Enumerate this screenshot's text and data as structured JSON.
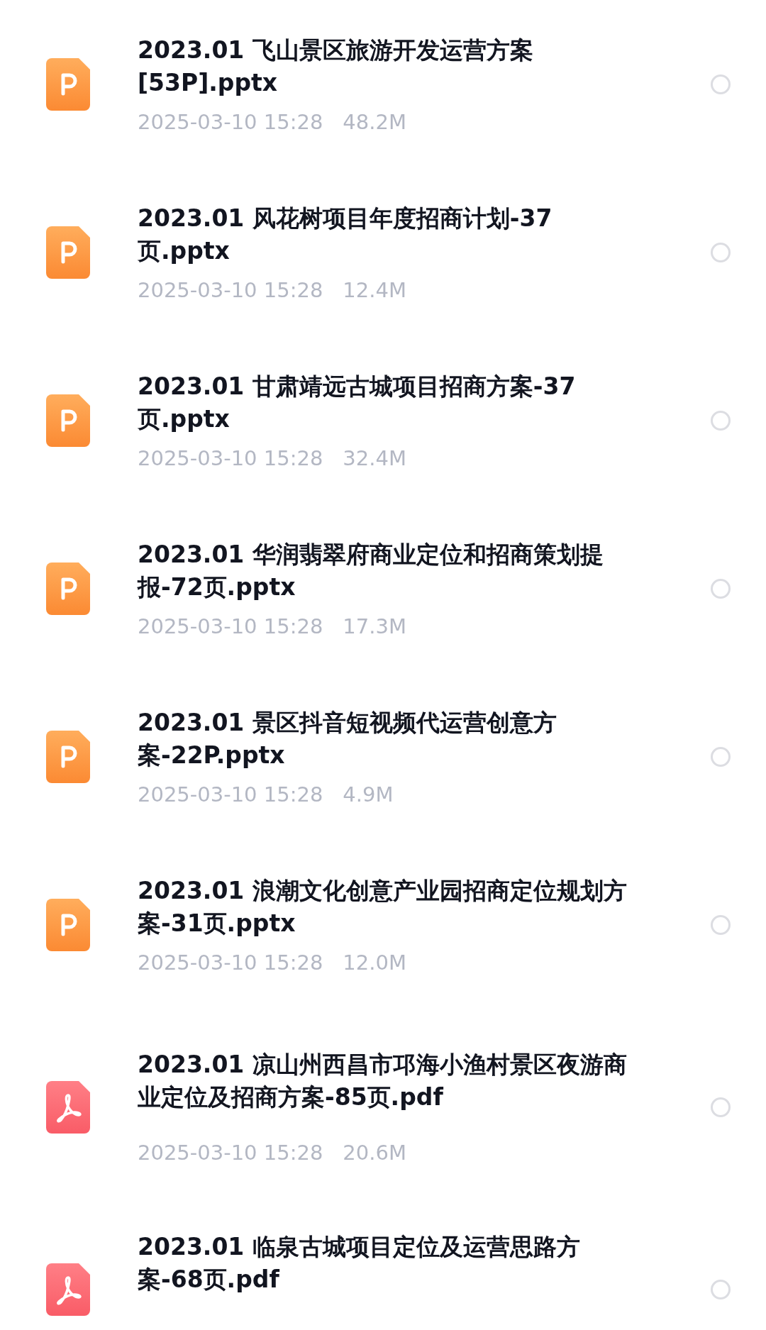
{
  "files": [
    {
      "kind": "pptx",
      "name": "2023.01 飞山景区旅游开发运营方案[53P].pptx",
      "date": "2025-03-10 15:28",
      "size": "48.2M",
      "selected": false
    },
    {
      "kind": "pptx",
      "name": "2023.01 风花树项目年度招商计划-37页.pptx",
      "date": "2025-03-10 15:28",
      "size": "12.4M",
      "selected": false
    },
    {
      "kind": "pptx",
      "name": "2023.01 甘肃靖远古城项目招商方案-37页.pptx",
      "date": "2025-03-10 15:28",
      "size": "32.4M",
      "selected": false
    },
    {
      "kind": "pptx",
      "name": "2023.01 华润翡翠府商业定位和招商策划提报-72页.pptx",
      "date": "2025-03-10 15:28",
      "size": "17.3M",
      "selected": false
    },
    {
      "kind": "pptx",
      "name": "2023.01 景区抖音短视频代运营创意方案-22P.pptx",
      "date": "2025-03-10 15:28",
      "size": "4.9M",
      "selected": false
    },
    {
      "kind": "pptx",
      "name": "2023.01 浪潮文化创意产业园招商定位规划方案-31页.pptx",
      "date": "2025-03-10 15:28",
      "size": "12.0M",
      "selected": false
    },
    {
      "kind": "pdf",
      "name": "2023.01 凉山州西昌市邛海小渔村景区夜游商业定位及招商方案-85页.pdf",
      "date": "2025-03-10 15:28",
      "size": "20.6M",
      "selected": false
    },
    {
      "kind": "pdf",
      "name": "2023.01 临泉古城项目定位及运营思路方案-68页.pdf",
      "selected": false
    }
  ]
}
